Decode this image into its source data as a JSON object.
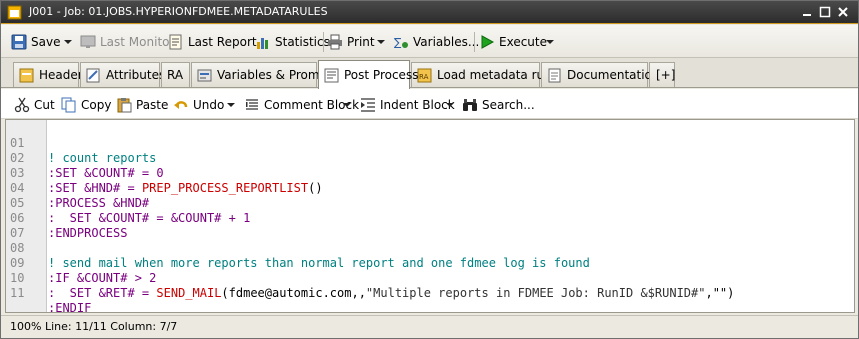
{
  "window": {
    "title": "J001 - Job: 01.JOBS.HYPERIONFDMEE.METADATARULES"
  },
  "toolbar": {
    "save": "Save",
    "last_monitor": "Last Monitor",
    "last_report": "Last Report",
    "statistics": "Statistics",
    "print": "Print",
    "variables": "Variables...",
    "execute": "Execute"
  },
  "tabs": [
    {
      "label": "Header"
    },
    {
      "label": "Attributes"
    },
    {
      "label": "RA"
    },
    {
      "label": "Variables & Prompts"
    },
    {
      "label": "Post Process",
      "active": true
    },
    {
      "label": "Load metadata rules"
    },
    {
      "label": "Documentation"
    },
    {
      "label": "[+]"
    }
  ],
  "editor_toolbar": {
    "cut": "Cut",
    "copy": "Copy",
    "paste": "Paste",
    "undo": "Undo",
    "comment_block": "Comment Block",
    "indent_block": "Indent Block",
    "search": "Search..."
  },
  "code": {
    "line_numbers": [
      "01",
      "02",
      "03",
      "04",
      "05",
      "06",
      "07",
      "08",
      "09",
      "10",
      "11"
    ],
    "l1": {
      "a": "! count reports"
    },
    "l2": {
      "a": ":SET",
      "b": " &COUNT# = 0"
    },
    "l3": {
      "a": ":SET",
      "b": " &HND# = ",
      "c": "PREP_PROCESS_REPORTLIST",
      "d": "()"
    },
    "l4": {
      "a": ":PROCESS",
      "b": " &HND#"
    },
    "l5": {
      "a": ":  SET",
      "b": " &COUNT# = &COUNT# + 1"
    },
    "l6": {
      "a": ":ENDPROCESS"
    },
    "l7": {
      "a": ""
    },
    "l8": {
      "a": "! send mail when more reports than normal report and one fdmee log is found"
    },
    "l9": {
      "a": ":IF",
      "b": " &COUNT# > 2"
    },
    "l10": {
      "a": ":  SET",
      "b": " &RET# = ",
      "c": "SEND_MAIL",
      "d": "(fdmee@automic.com,,",
      "e": "\"Multiple reports in FDMEE Job: RunID &$RUNID#\"",
      "f": ",\"\")"
    },
    "l11": {
      "a": ":ENDIF"
    }
  },
  "status": {
    "text": "100%  Line: 11/11  Column: 7/7"
  }
}
